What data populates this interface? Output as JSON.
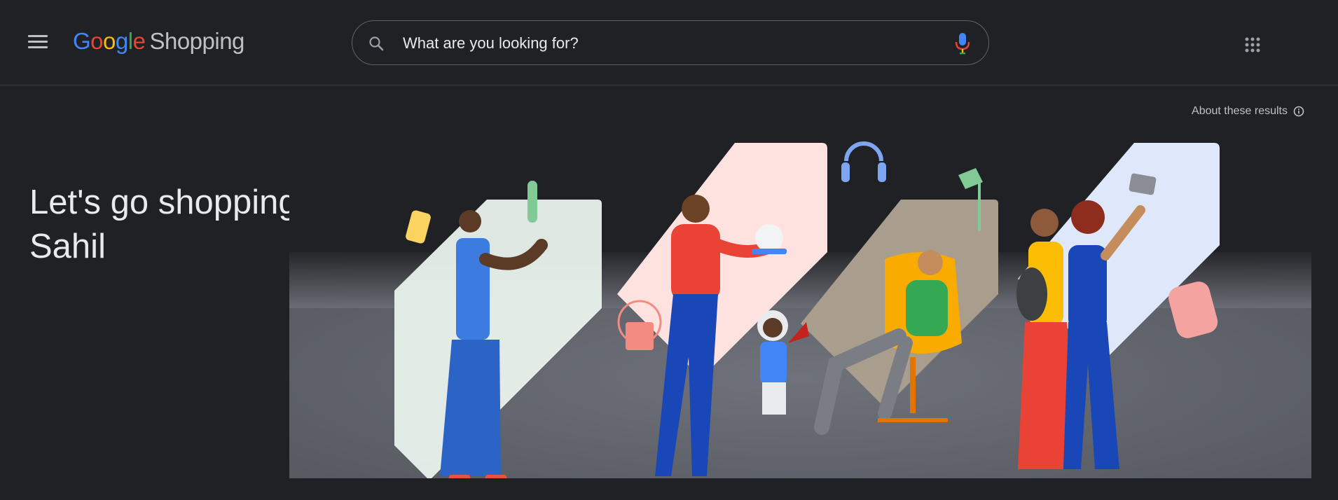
{
  "header": {
    "menu_icon": "hamburger-menu-icon",
    "logo": {
      "letters": [
        "G",
        "o",
        "o",
        "g",
        "l",
        "e"
      ],
      "product": "Shopping"
    },
    "search": {
      "placeholder": "What are you looking for?",
      "value": "",
      "search_icon": "search-icon",
      "mic_icon": "microphone-icon"
    },
    "apps_icon": "apps-grid-icon"
  },
  "about": {
    "label": "About these results",
    "icon": "info-icon"
  },
  "greeting": {
    "line1": "Let's go shopping,",
    "line2": "Sahil"
  },
  "colors": {
    "background": "#202124",
    "text": "#e8eaed",
    "muted": "#bdc1c6",
    "border": "#5f6368",
    "google_blue": "#4285f4",
    "google_red": "#ea4335",
    "google_yellow": "#fbbc04",
    "google_green": "#34a853"
  }
}
